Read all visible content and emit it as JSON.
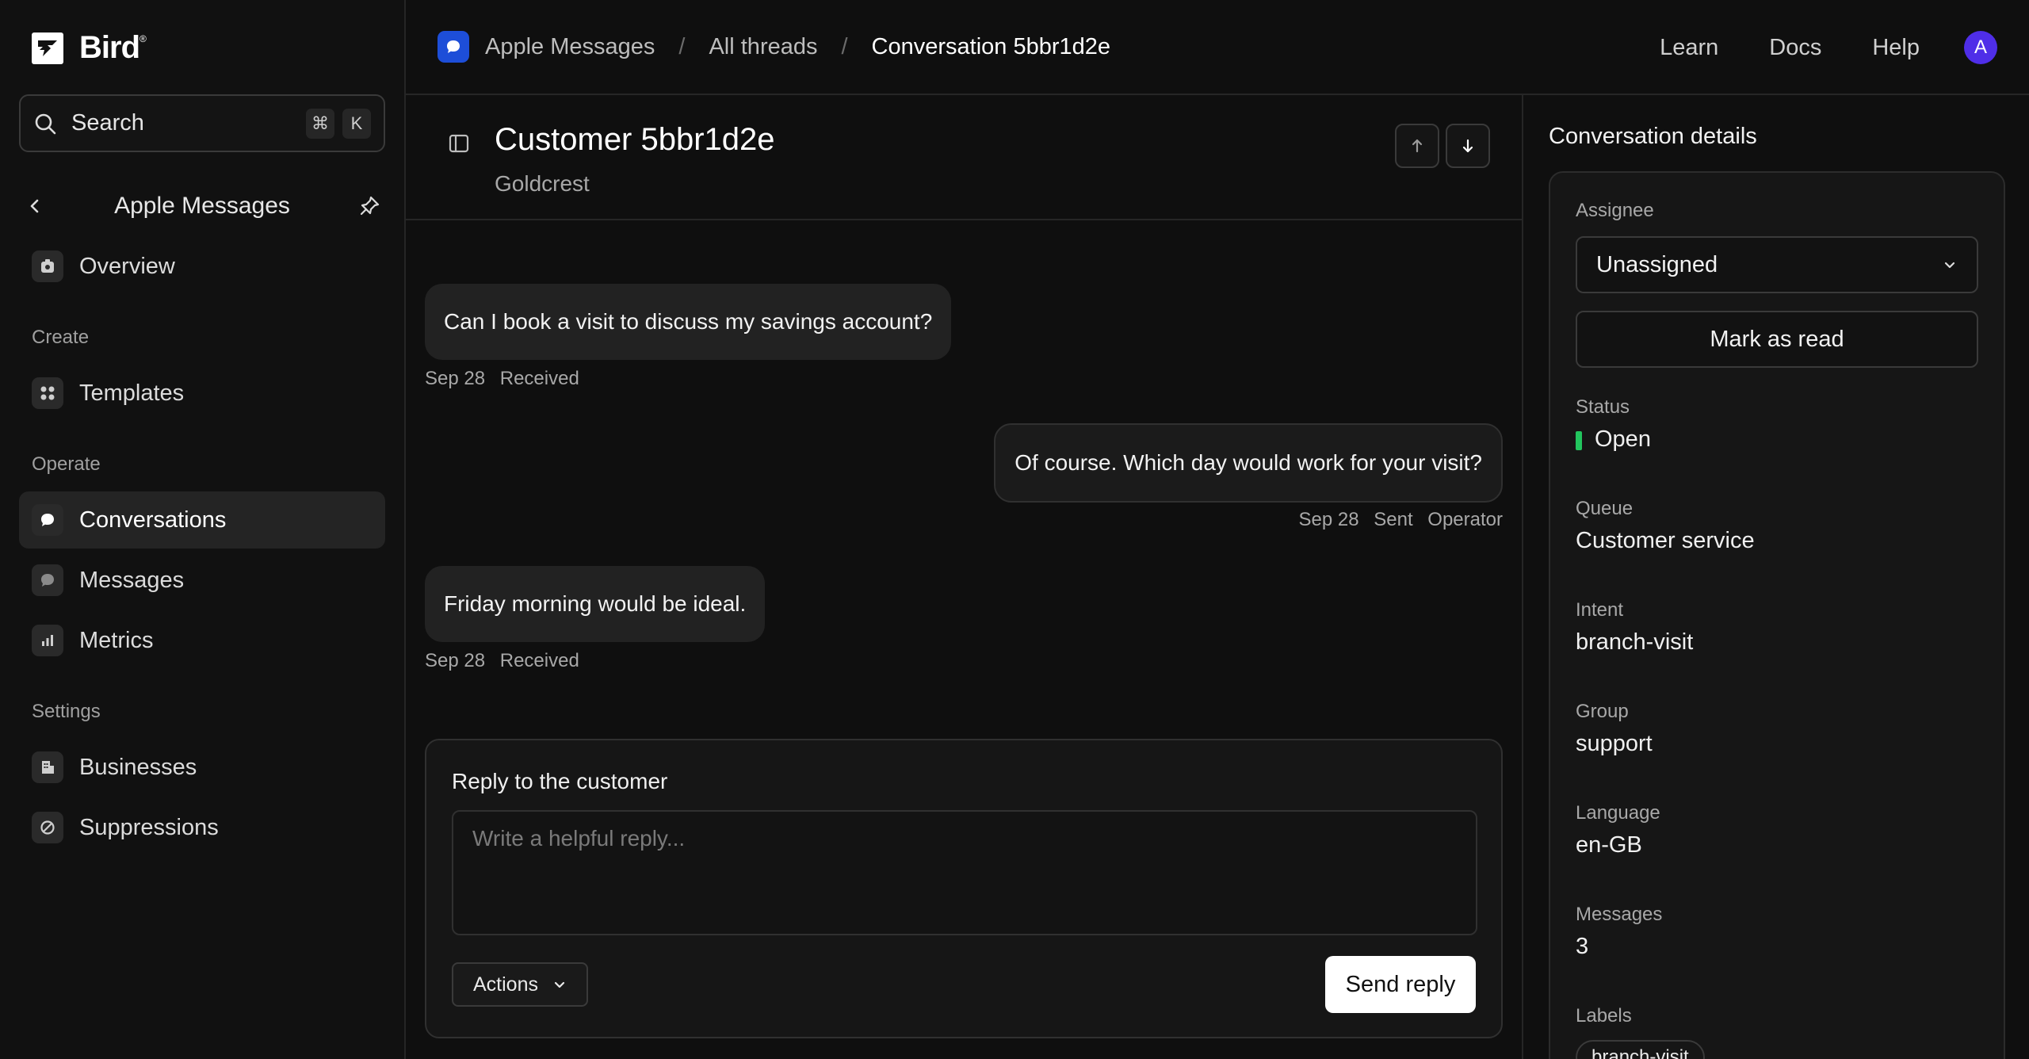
{
  "brand": {
    "name": "Bird",
    "mark": "®"
  },
  "search": {
    "label": "Search",
    "shortcut_mod": "⌘",
    "shortcut_key": "K"
  },
  "sidebar": {
    "section_title": "Apple Messages",
    "overview": "Overview",
    "groups": {
      "create": "Create",
      "operate": "Operate",
      "settings": "Settings"
    },
    "items": {
      "templates": "Templates",
      "conversations": "Conversations",
      "messages": "Messages",
      "metrics": "Metrics",
      "businesses": "Businesses",
      "suppressions": "Suppressions"
    },
    "active": "conversations"
  },
  "breadcrumb": {
    "channel": "Apple Messages",
    "threads": "All threads",
    "current": "Conversation 5bbr1d2e",
    "separator": "/"
  },
  "top_links": {
    "learn": "Learn",
    "docs": "Docs",
    "help": "Help",
    "avatar": "A"
  },
  "conversation": {
    "title": "Customer 5bbr1d2e",
    "subtitle": "Goldcrest",
    "messages": [
      {
        "text": "Can I book a visit to discuss my savings account?",
        "date": "Sep 28",
        "status": "Received",
        "sender": ""
      },
      {
        "text": "Of course. Which day would work for your visit?",
        "date": "Sep 28",
        "status": "Sent",
        "sender": "Operator"
      },
      {
        "text": "Friday morning would be ideal.",
        "date": "Sep 28",
        "status": "Received",
        "sender": ""
      }
    ]
  },
  "reply": {
    "title": "Reply to the customer",
    "placeholder": "Write a helpful reply...",
    "actions_label": "Actions",
    "send_label": "Send reply"
  },
  "details": {
    "title": "Conversation details",
    "assignee_label": "Assignee",
    "assignee_value": "Unassigned",
    "mark_read": "Mark as read",
    "status_label": "Status",
    "status_value": "Open",
    "status_color": "#22c55e",
    "queue_label": "Queue",
    "queue_value": "Customer service",
    "intent_label": "Intent",
    "intent_value": "branch-visit",
    "group_label": "Group",
    "group_value": "support",
    "language_label": "Language",
    "language_value": "en-GB",
    "messages_label": "Messages",
    "messages_value": "3",
    "labels_label": "Labels",
    "labels": [
      "branch-visit"
    ]
  },
  "colors": {
    "accent_blue": "#1d4ed8",
    "avatar": "#4f2ee8",
    "status_open": "#22c55e"
  }
}
